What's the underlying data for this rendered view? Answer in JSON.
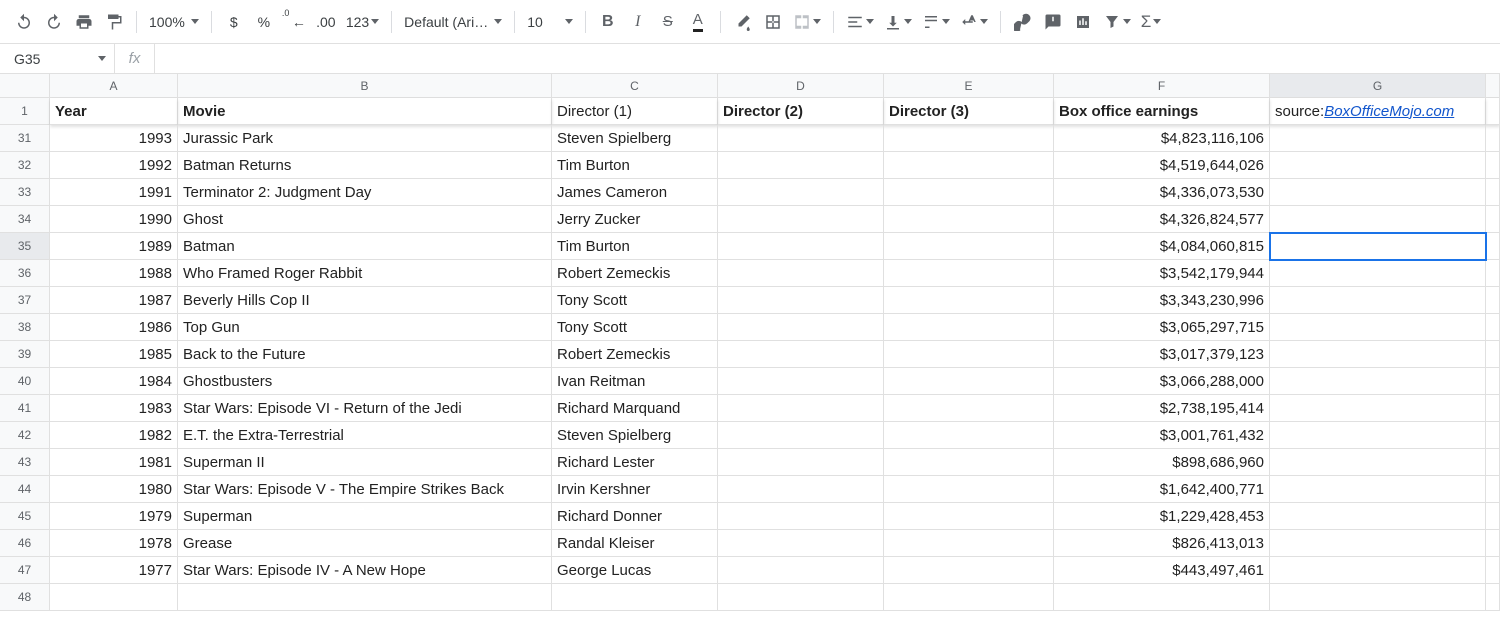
{
  "toolbar": {
    "zoom": "100%",
    "font_name": "Default (Ari…",
    "font_size": "10",
    "currency": "$",
    "percent": "%",
    "dec_less": ".0",
    "dec_more": ".00",
    "num_fmt": "123"
  },
  "namebox": "G35",
  "fx_label": "fx",
  "formula": "",
  "columns": [
    "A",
    "B",
    "C",
    "D",
    "E",
    "F",
    "G"
  ],
  "active_col": "G",
  "row_numbers": [
    "1",
    "31",
    "32",
    "33",
    "34",
    "35",
    "36",
    "37",
    "38",
    "39",
    "40",
    "41",
    "42",
    "43",
    "44",
    "45",
    "46",
    "47",
    "48"
  ],
  "active_row": "35",
  "header_row": {
    "year": "Year",
    "movie": "Movie",
    "d1": "Director (1)",
    "d2": "Director (2)",
    "d3": "Director (3)",
    "box": "Box office earnings",
    "source_prefix": "source: ",
    "source_link": "BoxOfficeMojo.com"
  },
  "rows": [
    {
      "year": "1993",
      "movie": "Jurassic Park",
      "d1": "Steven Spielberg",
      "d2": "",
      "d3": "",
      "box": "$4,823,116,106"
    },
    {
      "year": "1992",
      "movie": "Batman Returns",
      "d1": "Tim Burton",
      "d2": "",
      "d3": "",
      "box": "$4,519,644,026"
    },
    {
      "year": "1991",
      "movie": "Terminator 2: Judgment Day",
      "d1": "James Cameron",
      "d2": "",
      "d3": "",
      "box": "$4,336,073,530"
    },
    {
      "year": "1990",
      "movie": "Ghost",
      "d1": "Jerry Zucker",
      "d2": "",
      "d3": "",
      "box": "$4,326,824,577"
    },
    {
      "year": "1989",
      "movie": "Batman",
      "d1": "Tim Burton",
      "d2": "",
      "d3": "",
      "box": "$4,084,060,815"
    },
    {
      "year": "1988",
      "movie": "Who Framed Roger Rabbit",
      "d1": "Robert Zemeckis",
      "d2": "",
      "d3": "",
      "box": "$3,542,179,944"
    },
    {
      "year": "1987",
      "movie": "Beverly Hills Cop II",
      "d1": "Tony Scott",
      "d2": "",
      "d3": "",
      "box": "$3,343,230,996"
    },
    {
      "year": "1986",
      "movie": "Top Gun",
      "d1": "Tony Scott",
      "d2": "",
      "d3": "",
      "box": "$3,065,297,715"
    },
    {
      "year": "1985",
      "movie": "Back to the Future",
      "d1": "Robert Zemeckis",
      "d2": "",
      "d3": "",
      "box": "$3,017,379,123"
    },
    {
      "year": "1984",
      "movie": "Ghostbusters",
      "d1": "Ivan Reitman",
      "d2": "",
      "d3": "",
      "box": "$3,066,288,000"
    },
    {
      "year": "1983",
      "movie": "Star Wars: Episode VI - Return of the Jedi",
      "d1": "Richard Marquand",
      "d2": "",
      "d3": "",
      "box": "$2,738,195,414"
    },
    {
      "year": "1982",
      "movie": "E.T. the Extra-Terrestrial",
      "d1": "Steven Spielberg",
      "d2": "",
      "d3": "",
      "box": "$3,001,761,432"
    },
    {
      "year": "1981",
      "movie": "Superman II",
      "d1": "Richard Lester",
      "d2": "",
      "d3": "",
      "box": "$898,686,960"
    },
    {
      "year": "1980",
      "movie": "Star Wars: Episode V - The Empire Strikes Back",
      "d1": "Irvin Kershner",
      "d2": "",
      "d3": "",
      "box": "$1,642,400,771"
    },
    {
      "year": "1979",
      "movie": "Superman",
      "d1": "Richard Donner",
      "d2": "",
      "d3": "",
      "box": "$1,229,428,453"
    },
    {
      "year": "1978",
      "movie": "Grease",
      "d1": "Randal Kleiser",
      "d2": "",
      "d3": "",
      "box": "$826,413,013"
    },
    {
      "year": "1977",
      "movie": "Star Wars: Episode IV - A New Hope",
      "d1": "George Lucas",
      "d2": "",
      "d3": "",
      "box": "$443,497,461"
    }
  ]
}
